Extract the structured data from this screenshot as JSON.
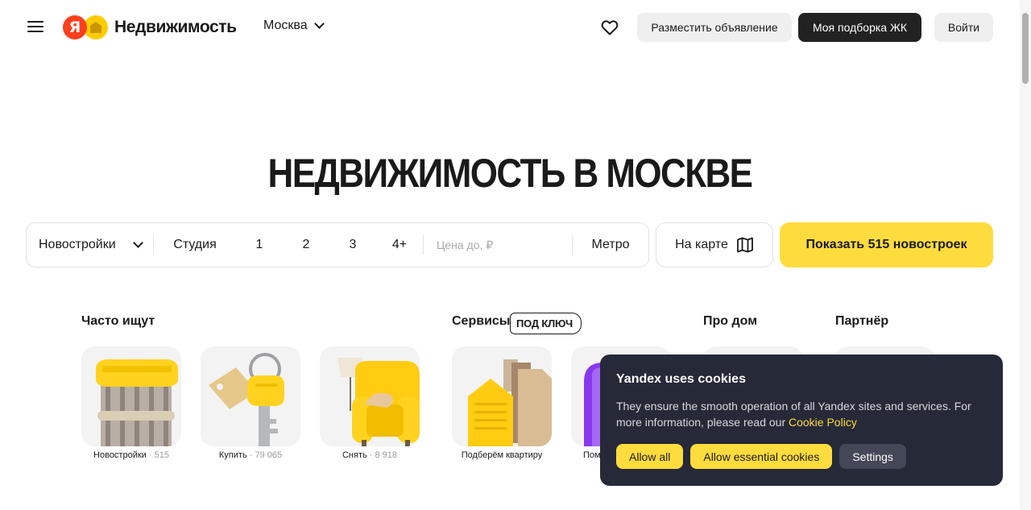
{
  "header": {
    "logo_letter": "Я",
    "logo_text": "Недвижимость",
    "city": "Москва",
    "post_ad": "Разместить объявление",
    "my_selection": "Моя подборка ЖК",
    "login": "Войти"
  },
  "hero": {
    "title": "НЕДВИЖИМОСТЬ В МОСКВЕ"
  },
  "search": {
    "property_type": "Новостройки",
    "rooms": [
      "Студия",
      "1",
      "2",
      "3",
      "4+"
    ],
    "price_placeholder": "Цена до, ₽",
    "metro": "Метро",
    "map_button": "На карте",
    "show_button": "Показать 515 новостроек"
  },
  "sections": {
    "often_searched": "Часто ищут",
    "services": "Сервисы",
    "services_badge": "ПОД КЛЮЧ",
    "about_home": "Про дом",
    "partner": "Партнёр"
  },
  "cards": [
    {
      "label": "Новостройки",
      "count": "515"
    },
    {
      "label": "Купить",
      "count": "79 065"
    },
    {
      "label": "Снять",
      "count": "8 918"
    },
    {
      "label": "Подберём квартиру",
      "count": ""
    },
    {
      "label": "Пом",
      "count": ""
    }
  ],
  "cookie": {
    "title": "Yandex uses cookies",
    "text": "They ensure the smooth operation of all Yandex sites and services. For more information, please read our ",
    "link": "Cookie Policy",
    "allow_all": "Allow all",
    "allow_essential": "Allow essential cookies",
    "settings": "Settings"
  },
  "colors": {
    "accent_yellow": "#ffdc3d",
    "brand_red": "#fc3f1d",
    "dark_button": "#222222",
    "cookie_bg": "#262938"
  },
  "icons": [
    "menu-icon",
    "heart-icon",
    "chevron-down-icon",
    "map-icon"
  ]
}
